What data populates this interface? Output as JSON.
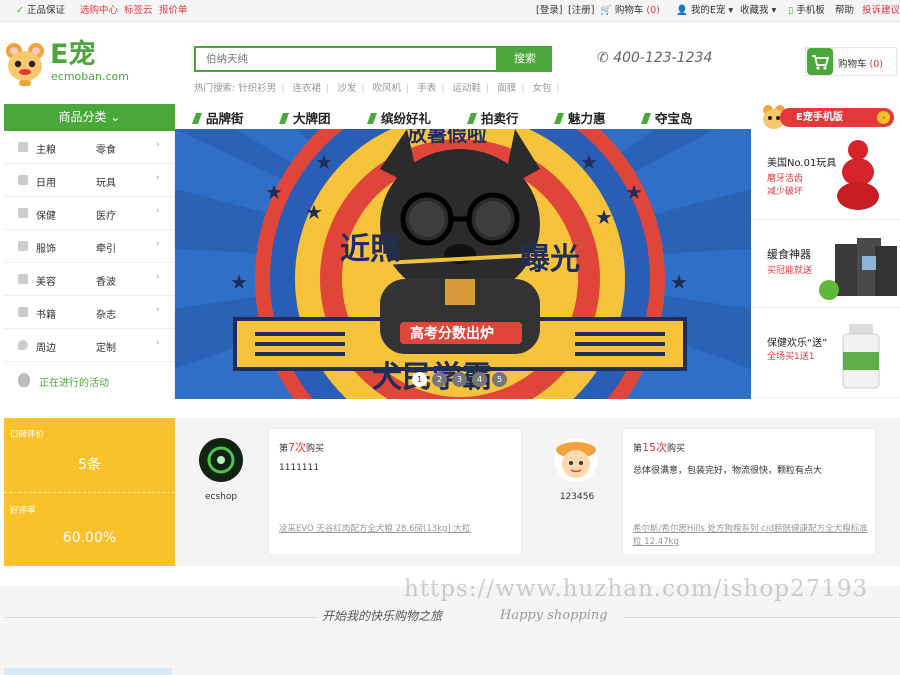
{
  "topbar": {
    "guarantee": "正品保证",
    "links_left": [
      "选购中心",
      "标签云",
      "报价单"
    ],
    "login": "[登录]",
    "register": "[注册]",
    "cart": "购物车",
    "cart_count": "(0)",
    "my": "我的E宠",
    "favorite": "收藏我",
    "mobile": "手机板",
    "help": "帮助",
    "complaint": "投诉建议"
  },
  "header": {
    "logo_text": "E宠",
    "logo_sub": "ecmoban.com",
    "search_placeholder": "伯纳天纯",
    "search_button": "搜索",
    "hot_label": "热门搜索:",
    "hot_terms": [
      "针织衫男",
      "连衣裙",
      "沙发",
      "吹风机",
      "手表",
      "运动鞋",
      "面膜",
      "女包"
    ],
    "phone": "400-123-1234",
    "cart_label": "购物车",
    "cart_count": "(0)"
  },
  "nav": {
    "category_title": "商品分类",
    "items": [
      "品牌街",
      "大牌团",
      "缤纷好礼",
      "拍卖行",
      "魅力惠",
      "夺宝岛"
    ],
    "mobile_tag": "E宠手机版"
  },
  "categories": [
    {
      "a": "主粮",
      "b": "零食"
    },
    {
      "a": "日用",
      "b": "玩具"
    },
    {
      "a": "保健",
      "b": "医疗"
    },
    {
      "a": "服饰",
      "b": "牵引"
    },
    {
      "a": "美容",
      "b": "香波"
    },
    {
      "a": "书籍",
      "b": "杂志"
    },
    {
      "a": "周边",
      "b": "定制"
    }
  ],
  "activity": "正在进行的活动",
  "banner": {
    "top_text": "放暑假啦",
    "left_text": "近照",
    "right_text": "曝光",
    "ribbon": "高考分数出炉",
    "main": "犬民学霸",
    "dots": [
      "1",
      "2",
      "3",
      "4",
      "5"
    ]
  },
  "side_ads": [
    {
      "title": "美国No.01玩具",
      "sub1": "磨牙洁齿",
      "sub2": "减少破坏"
    },
    {
      "title": "缓食神器",
      "sub1": "买冠能就送",
      "sub2": ""
    },
    {
      "title": "保健欢乐“送”",
      "sub1": "全场买1送1",
      "sub2": ""
    }
  ],
  "stats": {
    "label1": "口碑评价",
    "value1": "5条",
    "label2": "好评率",
    "value2": "60.00%"
  },
  "reviews": [
    {
      "user": "ecshop",
      "buy_pre": "第",
      "buy_n": "7次",
      "buy_post": "购买",
      "text": "1111111",
      "product": "凌采EVO 无谷红肉配方全犬粮 28.6磅(13kg) 大粒"
    },
    {
      "user": "123456",
      "buy_pre": "第",
      "buy_n": "15次",
      "buy_post": "购买",
      "text": "总体很满意，包装完好，物流很快，颗粒有点大",
      "product": "希尔斯/希尔思Hills 处方狗粮系列 c/d膀胱健康配方全犬粮标准粒 12.47kg"
    }
  ],
  "footer": {
    "slogan_cn": "开始我的快乐购物之旅",
    "slogan_en": "Happy shopping",
    "watermark": "https://www.huzhan.com/ishop27193"
  },
  "colors": {
    "brand_green": "#4aa83a",
    "accent_red": "#e4393c",
    "stat_yellow": "#f9c22b",
    "banner_blue": "#2f6fc7"
  }
}
